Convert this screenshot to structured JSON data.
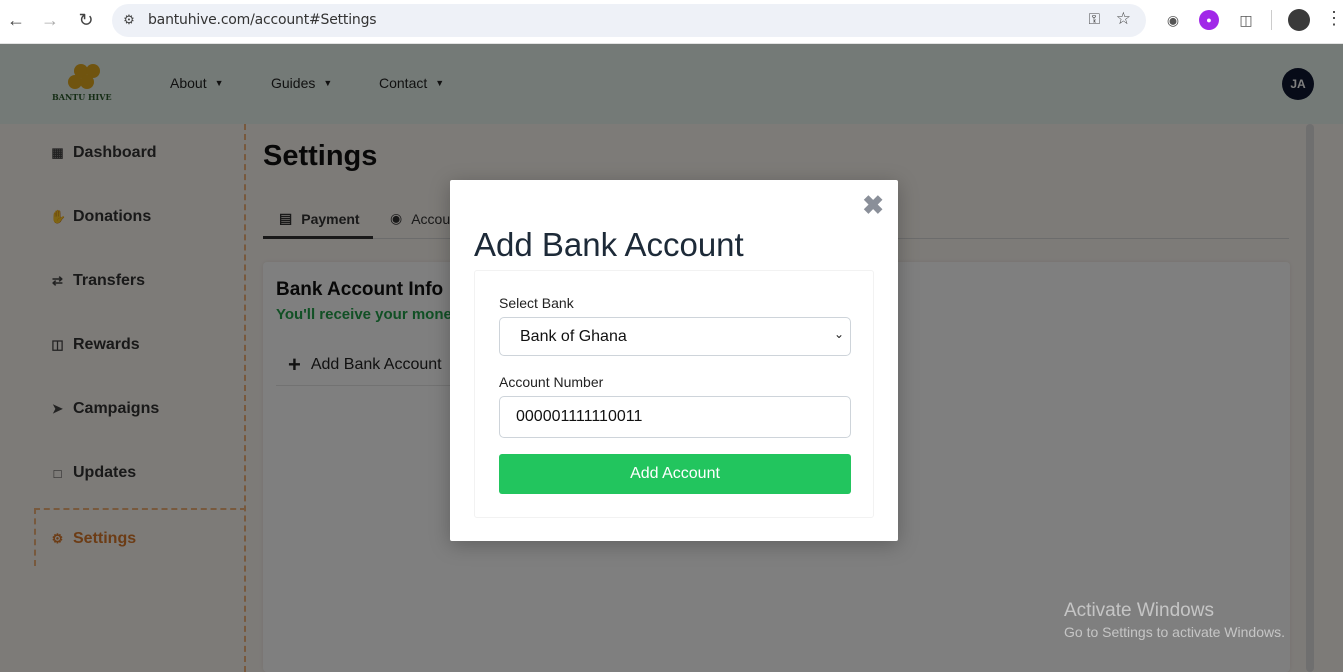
{
  "browser": {
    "url": "bantuhive.com/account#Settings"
  },
  "header": {
    "logo_text": "BANTU HIVE",
    "nav": [
      "About",
      "Guides",
      "Contact"
    ],
    "avatar_initials": "JA"
  },
  "sidebar": {
    "items": [
      {
        "label": "Dashboard",
        "icon": "grid-icon"
      },
      {
        "label": "Donations",
        "icon": "hand-icon"
      },
      {
        "label": "Transfers",
        "icon": "arrows-icon"
      },
      {
        "label": "Rewards",
        "icon": "gift-icon"
      },
      {
        "label": "Campaigns",
        "icon": "rocket-icon"
      },
      {
        "label": "Updates",
        "icon": "chat-icon"
      },
      {
        "label": "Settings",
        "icon": "gear-icon",
        "active": true
      }
    ]
  },
  "main": {
    "title": "Settings",
    "tabs": [
      "Payment",
      "Accou"
    ],
    "card_title": "Bank Account Info",
    "card_subtitle": "You'll receive your mone",
    "add_bank_label": "Add Bank Account"
  },
  "modal": {
    "title": "Add Bank Account",
    "select_bank_label": "Select Bank",
    "selected_bank": "Bank of Ghana",
    "account_number_label": "Account Number",
    "account_number_value": "000001111110011",
    "submit_label": "Add Account"
  },
  "watermark": {
    "line1": "Activate Windows",
    "line2": "Go to Settings to activate Windows."
  },
  "colors": {
    "accent_green": "#22c55e",
    "active_orange": "#d9782a",
    "header_bg": "#e9f5ee"
  }
}
